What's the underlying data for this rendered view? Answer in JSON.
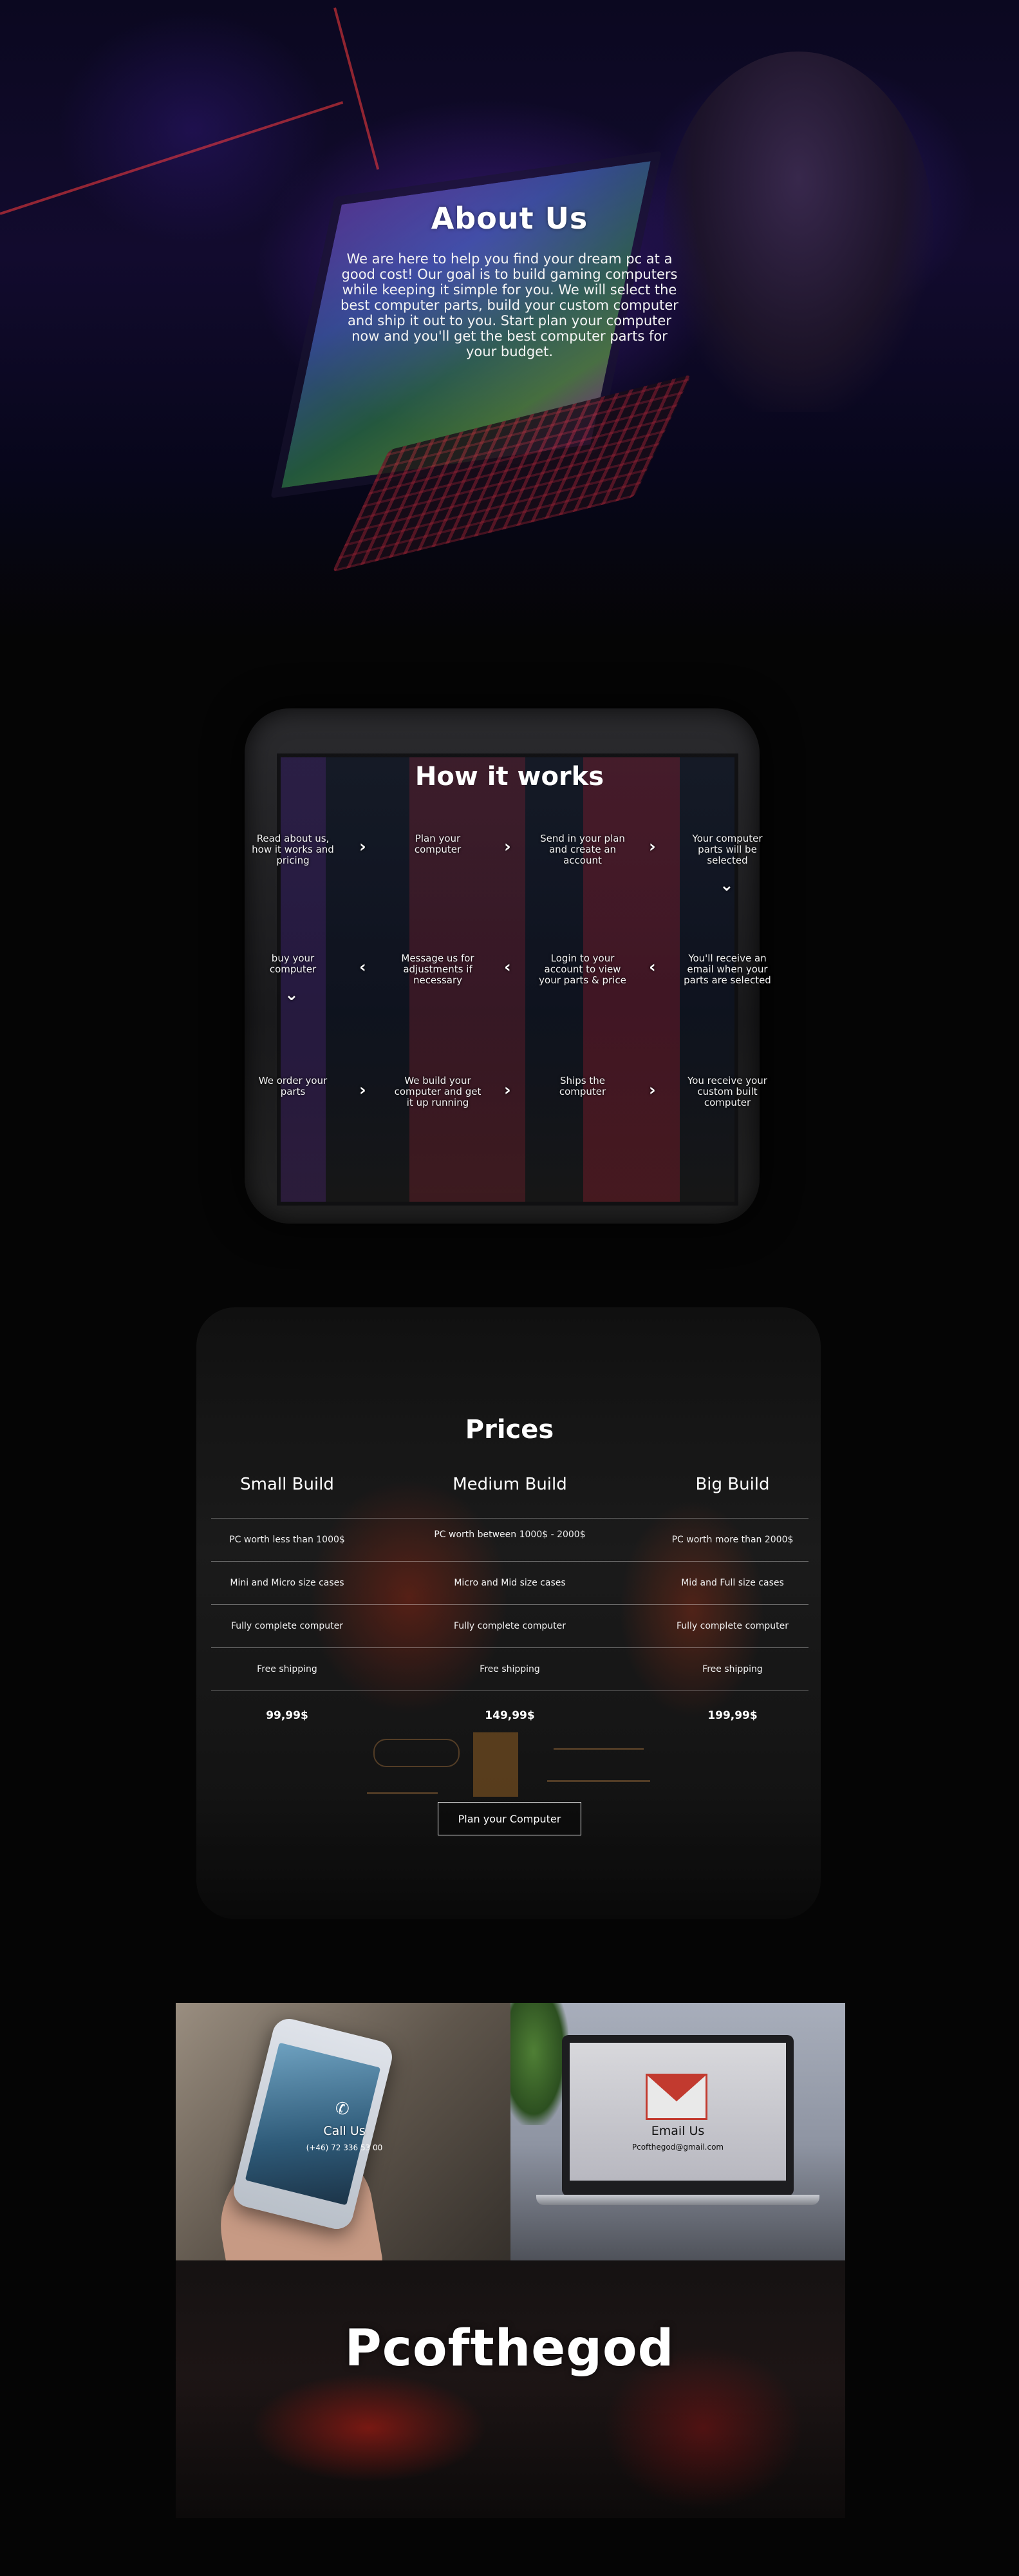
{
  "about": {
    "title": "About Us",
    "text": "We are here to help you find your dream pc at a good cost! Our goal is to build gaming computers while keeping it simple for you. We will select the best computer parts, build your custom computer and ship it out to you. Start plan your computer now and you'll get the best computer parts for your budget."
  },
  "how": {
    "title": "How it works",
    "steps": [
      "Read about us, how it works and pricing",
      "Plan your computer",
      "Send in your plan and create an account",
      "Your computer parts will be selected",
      "buy your computer",
      "Message us for adjustments if necessary",
      "Login to your account to view your parts & price",
      "You'll receive an email when your parts are selected",
      "We order your parts",
      "We build your computer and get it up running",
      "Ships the computer",
      "You receive your custom built computer"
    ],
    "arrow_right": "›",
    "arrow_left": "‹",
    "arrow_down": "⌄"
  },
  "prices": {
    "title": "Prices",
    "columns": [
      {
        "name": "Small Build",
        "rows": [
          "PC worth less than 1000$",
          "Mini and Micro size cases",
          "Fully complete computer",
          "Free shipping"
        ],
        "price": "99,99$"
      },
      {
        "name": "Medium Build",
        "rows": [
          "PC worth between 1000$ - 2000$",
          "Micro and Mid size cases",
          "Fully complete computer",
          "Free shipping"
        ],
        "price": "149,99$"
      },
      {
        "name": "Big Build",
        "rows": [
          "PC worth more than 2000$",
          "Mid and Full size cases",
          "Fully complete computer",
          "Free shipping"
        ],
        "price": "199,99$"
      }
    ],
    "button": "Plan your Computer"
  },
  "contact": {
    "call": {
      "title": "Call Us",
      "number": "(+46) 72 336 53 00",
      "icon": "phone-icon"
    },
    "mail": {
      "title": "Email Us",
      "address": "Pcofthegod@gmail.com",
      "icon": "gmail-icon"
    }
  },
  "footer": {
    "brand": "Pcofthegod"
  }
}
